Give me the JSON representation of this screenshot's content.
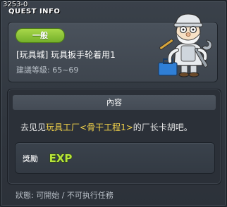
{
  "window": {
    "quest_id": "3253-0",
    "title": "QUEST INFO"
  },
  "header": {
    "type_badge": "一般",
    "quest_name": "[玩具城] 玩具扳手轮着用1",
    "level_requirement": "建議等級: 65~69",
    "npc_portrait": "toy-factory-foreman-npc"
  },
  "content": {
    "section_title": "內容",
    "description": {
      "part1": "去见见",
      "highlight": "玩具工厂<骨干工程1>",
      "part2": "的厂长卡胡吧。"
    },
    "highlight_color": "#f2d24a"
  },
  "reward": {
    "label": "獎勵",
    "exp_text": "EXP",
    "exp_color": "#b7e33a"
  },
  "status": {
    "text": "狀態: 可開始 / 不可执行任務"
  },
  "colors": {
    "badge_green": "#8cc63a",
    "window_bg": "#30363e"
  }
}
